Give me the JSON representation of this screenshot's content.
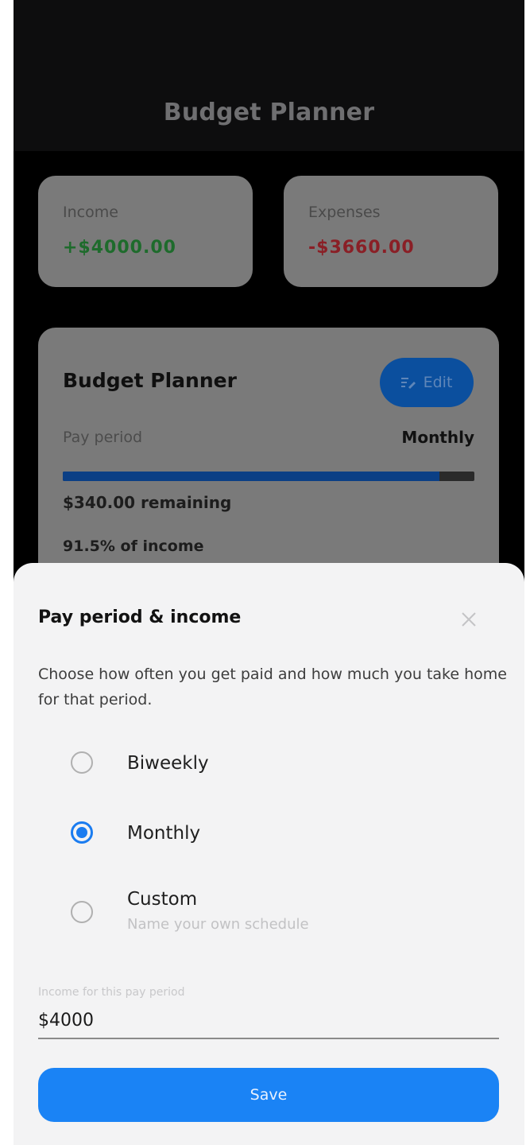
{
  "header": {
    "title": "Budget Planner"
  },
  "summary": {
    "income": {
      "label": "Income",
      "value": "+$4000.00"
    },
    "expenses": {
      "label": "Expenses",
      "value": "-$3660.00"
    }
  },
  "planner": {
    "title": "Budget Planner",
    "edit_label": "Edit",
    "pay_period_label": "Pay period",
    "pay_period_value": "Monthly",
    "progress_fraction": 0.915,
    "remaining_text": "$340.00 remaining",
    "percent_text": "91.5% of income"
  },
  "sheet": {
    "title": "Pay period & income",
    "description": "Choose how often you get paid and how much you take home for that period.",
    "options": [
      {
        "label": "Biweekly",
        "sub": "",
        "selected": false
      },
      {
        "label": "Monthly",
        "sub": "",
        "selected": true
      },
      {
        "label": "Custom",
        "sub": "Name your own schedule",
        "selected": false
      }
    ],
    "income_field_label": "Income for this pay period",
    "income_field_value": "$4000",
    "save_label": "Save"
  },
  "colors": {
    "accent": "#1a83f5",
    "income": "#1e6b2c",
    "expenses": "#8a1f26"
  }
}
